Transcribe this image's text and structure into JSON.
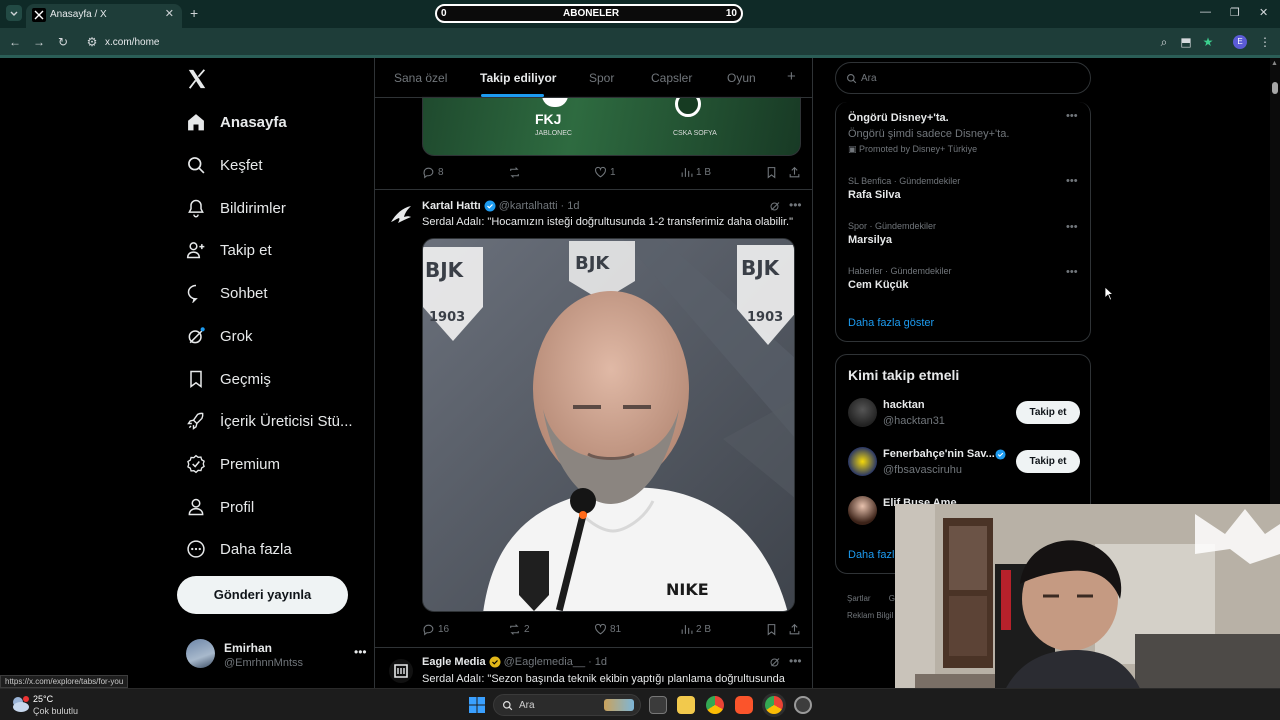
{
  "browser": {
    "tab_title": "Anasayfa / X",
    "url": "x.com/home",
    "subscriber_counter": {
      "label": "ABONELER",
      "left_value": "0",
      "right_value": "10"
    },
    "status_url": "https://x.com/explore/tabs/for-you"
  },
  "sidebar": {
    "items": [
      {
        "label": "Anasayfa",
        "icon": "home-icon"
      },
      {
        "label": "Keşfet",
        "icon": "search-icon"
      },
      {
        "label": "Bildirimler",
        "icon": "bell-icon"
      },
      {
        "label": "Takip et",
        "icon": "add-user-icon"
      },
      {
        "label": "Sohbet",
        "icon": "chat-icon"
      },
      {
        "label": "Grok",
        "icon": "grok-icon"
      },
      {
        "label": "Geçmiş",
        "icon": "bookmark-icon"
      },
      {
        "label": "İçerik Üreticisi Stü...",
        "icon": "rocket-icon"
      },
      {
        "label": "Premium",
        "icon": "premium-icon"
      },
      {
        "label": "Profil",
        "icon": "person-icon"
      },
      {
        "label": "Daha fazla",
        "icon": "more-circle-icon"
      }
    ],
    "post_button": "Gönderi yayınla",
    "profile": {
      "name": "Emirhan",
      "handle": "@EmrhnnMntss"
    }
  },
  "timeline": {
    "tabs": [
      "Sana özel",
      "Takip ediliyor",
      "Spor",
      "Capsler",
      "Oyun"
    ],
    "active_tab": "Takip ediliyor",
    "previous_post": {
      "media_team_left": "FKJ",
      "media_sub_left": "JABLONEC",
      "media_sub_right": "CSKA SOFYA",
      "replies": "8",
      "reposts": "",
      "likes": "1",
      "views": "1 B"
    },
    "posts": [
      {
        "name": "Kartal Hattı",
        "handle": "@kartalhatti",
        "time": "· 1d",
        "text": "Serdal Adalı: \"Hocamızın isteği doğrultusunda 1-2 transferimiz daha olabilir.\"",
        "replies": "16",
        "reposts": "2",
        "likes": "81",
        "views": "2 B"
      },
      {
        "name": "Eagle Media",
        "handle": "@Eaglemedia__",
        "time": "· 1d",
        "text": "Serdal Adalı: \"Sezon başında teknik ekibin yaptığı planlama doğrultusunda"
      }
    ]
  },
  "right": {
    "search_placeholder": "Ara",
    "promo": {
      "title": "Öngörü Disney+'ta.",
      "desc": "Öngörü şimdi sadece Disney+'ta.",
      "by": "Promoted by Disney+ Türkiye"
    },
    "trends": [
      {
        "meta": "SL Benfica · Gündemdekiler",
        "title": "Rafa Silva"
      },
      {
        "meta": "Spor · Gündemdekiler",
        "title": "Marsilya"
      },
      {
        "meta": "Haberler · Gündemdekiler",
        "title": "Cem Küçük"
      }
    ],
    "show_more": "Daha fazla göster",
    "who_to_follow_title": "Kimi takip etmeli",
    "who_to_follow": [
      {
        "name": "hacktan",
        "handle": "@hacktan31",
        "button": "Takip et"
      },
      {
        "name": "Fenerbahçe'nin Sav...",
        "handle": "@fbsavasciruhu",
        "button": "Takip et"
      },
      {
        "name": "Elif Buse Ame",
        "handle": "",
        "button": ""
      }
    ],
    "who_more": "Daha fazla",
    "footer": [
      "Şartlar",
      "Gi",
      "Reklam Bilgil"
    ]
  },
  "taskbar": {
    "temperature": "25°C",
    "weather": "Çok bulutlu",
    "search": "Ara"
  },
  "colors": {
    "accent": "#1d9bf0",
    "chrome": "#1e3d39",
    "background": "#000000"
  }
}
